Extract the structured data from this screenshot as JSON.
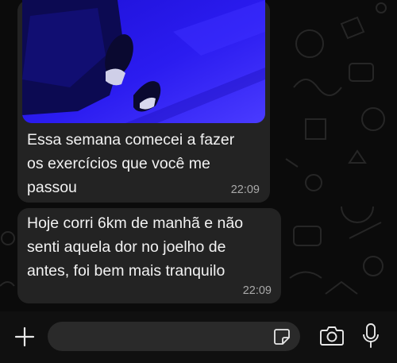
{
  "chat": {
    "messages": [
      {
        "has_photo": true,
        "text": "Essa semana comecei a fazer\nos exercícios que você me\npassou",
        "time": "22:09"
      },
      {
        "text": "Hoje corri 6km de manhã e não\nsenti aquela dor no joelho de\nantes, foi bem mais tranquilo",
        "time": "22:09"
      }
    ]
  },
  "composer": {
    "placeholder": "",
    "icons": [
      "plus-icon",
      "sticker-icon",
      "camera-icon",
      "microphone-icon"
    ]
  },
  "colors": {
    "background": "#0b0b0b",
    "bubble": "#232323",
    "text": "#f2f2f2",
    "timestamp": "#a9a9a9",
    "composer_bar": "#101010",
    "composer_input": "#2a2a2a"
  }
}
